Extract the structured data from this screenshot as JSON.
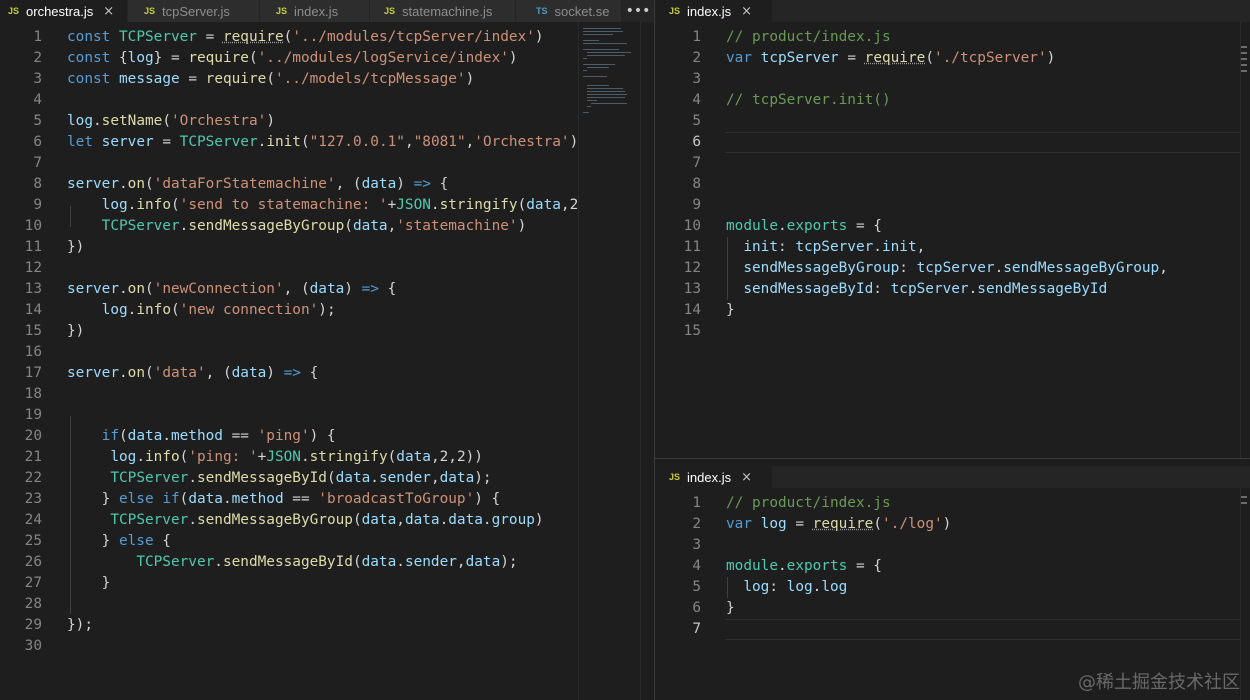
{
  "left_group": {
    "tabs": [
      {
        "icon": "JS",
        "label": "orchestra.js",
        "active": true
      },
      {
        "icon": "JS",
        "label": "tcpServer.js",
        "active": false
      },
      {
        "icon": "JS",
        "label": "index.js",
        "active": false
      },
      {
        "icon": "JS",
        "label": "statemachine.js",
        "active": false
      },
      {
        "icon": "TS",
        "label": "socket.se",
        "active": false
      }
    ],
    "more_label": "•••",
    "line_numbers": [
      "1",
      "2",
      "3",
      "4",
      "5",
      "6",
      "7",
      "8",
      "9",
      "10",
      "11",
      "12",
      "13",
      "14",
      "15",
      "16",
      "17",
      "18",
      "19",
      "20",
      "21",
      "22",
      "23",
      "24",
      "25",
      "26",
      "27",
      "28",
      "29",
      "30"
    ]
  },
  "top_right_group": {
    "tab": {
      "icon": "JS",
      "label": "index.js",
      "close": "×"
    },
    "line_numbers": [
      "1",
      "2",
      "3",
      "4",
      "5",
      "6",
      "7",
      "8",
      "9",
      "10",
      "11",
      "12",
      "13",
      "14",
      "15"
    ]
  },
  "bottom_right_group": {
    "tab": {
      "icon": "JS",
      "label": "index.js",
      "close": "×"
    },
    "line_numbers": [
      "1",
      "2",
      "3",
      "4",
      "5",
      "6",
      "7"
    ]
  },
  "watermark": "@稀土掘金技术社区"
}
